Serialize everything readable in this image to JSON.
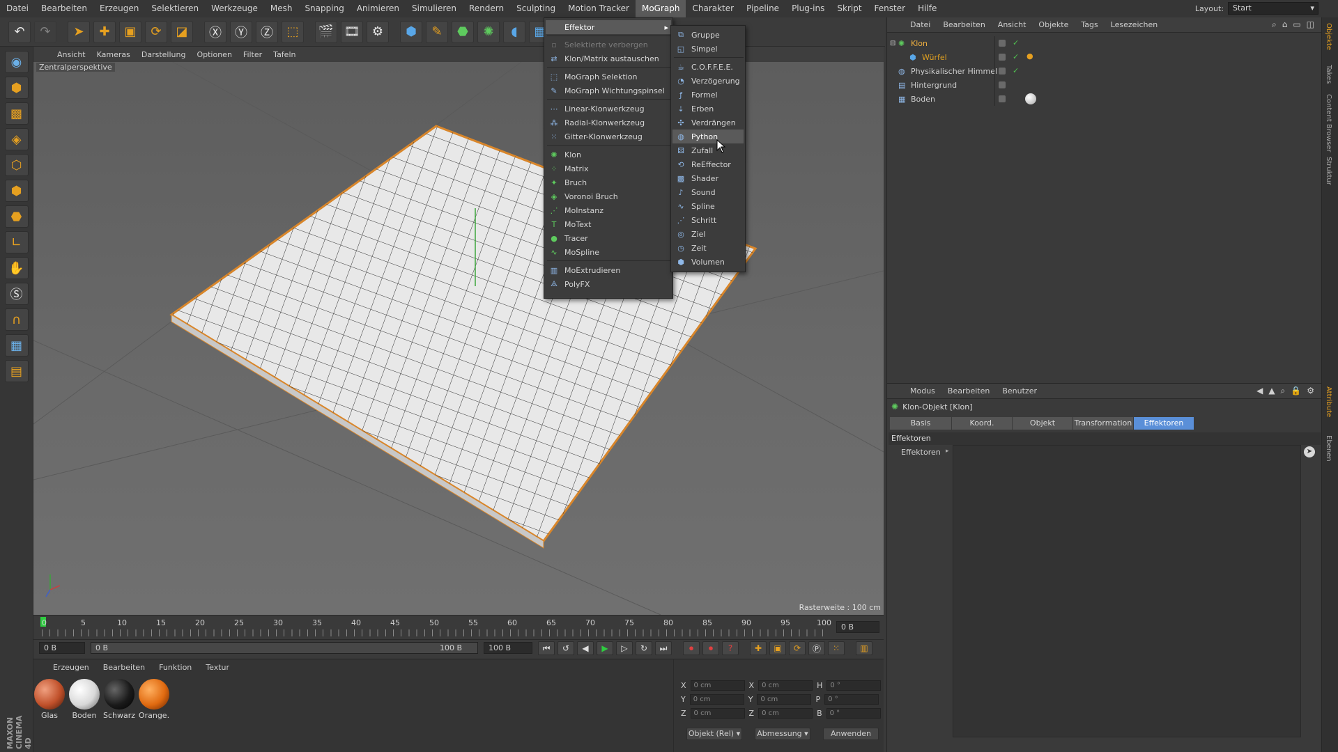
{
  "menubar": {
    "items": [
      "Datei",
      "Bearbeiten",
      "Erzeugen",
      "Selektieren",
      "Werkzeuge",
      "Mesh",
      "Snapping",
      "Animieren",
      "Simulieren",
      "Rendern",
      "Sculpting",
      "Motion Tracker",
      "MoGraph",
      "Charakter",
      "Pipeline",
      "Plug-ins",
      "Skript",
      "Fenster",
      "Hilfe"
    ],
    "active": "MoGraph",
    "layout_label": "Layout:",
    "layout_value": "Start"
  },
  "viewport": {
    "menu": [
      "Ansicht",
      "Kameras",
      "Darstellung",
      "Optionen",
      "Filter",
      "Tafeln"
    ],
    "label": "Zentralperspektive",
    "raster": "Rasterweite : 100 cm"
  },
  "timeline": {
    "ticks": [
      "0",
      "5",
      "10",
      "15",
      "20",
      "25",
      "30",
      "35",
      "40",
      "45",
      "50",
      "55",
      "60",
      "65",
      "70",
      "75",
      "80",
      "85",
      "90",
      "95",
      "100"
    ],
    "frame_end_label": "0 B",
    "start_field": "0 B",
    "range_start": "0 B",
    "range_end": "100 B",
    "end_field": "100 B"
  },
  "materials": {
    "menu": [
      "Erzeugen",
      "Bearbeiten",
      "Funktion",
      "Textur"
    ],
    "items": [
      {
        "label": "Glas",
        "color": "#c0502a"
      },
      {
        "label": "Boden",
        "color": "#d8d8d8"
      },
      {
        "label": "Schwarz",
        "color": "#1a1a1a"
      },
      {
        "label": "Orange.",
        "color": "#e06a10"
      }
    ]
  },
  "coords": {
    "rows": [
      {
        "a": "X",
        "av": "0 cm",
        "b": "X",
        "bv": "0 cm",
        "c": "H",
        "cv": "0 °"
      },
      {
        "a": "Y",
        "av": "0 cm",
        "b": "Y",
        "bv": "0 cm",
        "c": "P",
        "cv": "0 °"
      },
      {
        "a": "Z",
        "av": "0 cm",
        "b": "Z",
        "bv": "0 cm",
        "c": "B",
        "cv": "0 °"
      }
    ],
    "mode_select": "Objekt (Rel)",
    "size_select": "Abmessung",
    "apply": "Anwenden"
  },
  "objects": {
    "menu": [
      "Datei",
      "Bearbeiten",
      "Ansicht",
      "Objekte",
      "Tags",
      "Lesezeichen"
    ],
    "rows": [
      {
        "name": "Klon",
        "color": "#f0b040"
      },
      {
        "name": "Würfel",
        "color": "#e0a020"
      },
      {
        "name": "Physikalischer Himmel",
        "color": "#d0d0d0"
      },
      {
        "name": "Hintergrund",
        "color": "#d0d0d0"
      },
      {
        "name": "Boden",
        "color": "#d0d0d0"
      }
    ]
  },
  "attributes": {
    "menu": [
      "Modus",
      "Bearbeiten",
      "Benutzer"
    ],
    "title": "Klon-Objekt [Klon]",
    "tabs": [
      "Basis",
      "Koord.",
      "Objekt",
      "Transformation",
      "Effektoren"
    ],
    "active_tab": "Effektoren",
    "section": "Effektoren",
    "field_label": "Effektoren"
  },
  "sidetabs": [
    "Objekte",
    "Takes",
    "Content Browser",
    "Struktur",
    "Attribute",
    "Ebenen"
  ],
  "mograph_menu": {
    "items": [
      {
        "label": "Effektor",
        "type": "sub"
      },
      {
        "label": "Selektierte verbergen",
        "type": "disabled"
      },
      {
        "label": "Klon/Matrix austauschen",
        "type": "item"
      },
      {
        "label": "MoGraph Selektion",
        "type": "item"
      },
      {
        "label": "MoGraph Wichtungspinsel",
        "type": "item"
      },
      {
        "label": "Linear-Klonwerkzeug",
        "type": "item"
      },
      {
        "label": "Radial-Klonwerkzeug",
        "type": "item"
      },
      {
        "label": "Gitter-Klonwerkzeug",
        "type": "item"
      },
      {
        "label": "Klon",
        "type": "item"
      },
      {
        "label": "Matrix",
        "type": "item"
      },
      {
        "label": "Bruch",
        "type": "item"
      },
      {
        "label": "Voronoi Bruch",
        "type": "item"
      },
      {
        "label": "MoInstanz",
        "type": "item"
      },
      {
        "label": "MoText",
        "type": "item"
      },
      {
        "label": "Tracer",
        "type": "item"
      },
      {
        "label": "MoSpline",
        "type": "item"
      },
      {
        "label": "MoExtrudieren",
        "type": "item"
      },
      {
        "label": "PolyFX",
        "type": "item"
      }
    ]
  },
  "effektor_menu": {
    "items": [
      "Gruppe",
      "Simpel",
      "C.O.F.F.E.E.",
      "Verzögerung",
      "Formel",
      "Erben",
      "Verdrängen",
      "Python",
      "Zufall",
      "ReEffector",
      "Shader",
      "Sound",
      "Spline",
      "Schritt",
      "Ziel",
      "Zeit",
      "Volumen"
    ],
    "highlighted": "Python"
  }
}
